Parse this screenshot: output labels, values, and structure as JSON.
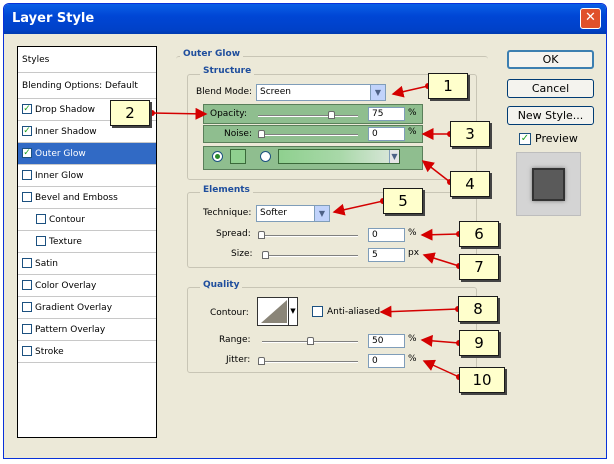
{
  "window": {
    "title": "Layer Style",
    "close_glyph": "✕"
  },
  "left_panel": {
    "header": "Styles",
    "blending": "Blending Options: Default",
    "items": [
      {
        "label": "Drop Shadow",
        "checked": true
      },
      {
        "label": "Inner Shadow",
        "checked": true
      },
      {
        "label": "Outer Glow",
        "checked": true
      },
      {
        "label": "Inner Glow",
        "checked": false
      },
      {
        "label": "Bevel and Emboss",
        "checked": false
      },
      {
        "label": "Contour",
        "checked": false
      },
      {
        "label": "Texture",
        "checked": false
      },
      {
        "label": "Satin",
        "checked": false
      },
      {
        "label": "Color Overlay",
        "checked": false
      },
      {
        "label": "Gradient Overlay",
        "checked": false
      },
      {
        "label": "Pattern Overlay",
        "checked": false
      },
      {
        "label": "Stroke",
        "checked": false
      }
    ]
  },
  "outer_glow": {
    "title": "Outer Glow",
    "structure": {
      "title": "Structure",
      "blend_mode_label": "Blend Mode:",
      "blend_mode_value": "Screen",
      "opacity_label": "Opacity:",
      "opacity_value": "75",
      "opacity_unit": "%",
      "opacity_fraction": 0.75,
      "noise_label": "Noise:",
      "noise_value": "0",
      "noise_unit": "%",
      "noise_fraction": 0
    },
    "elements": {
      "title": "Elements",
      "technique_label": "Technique:",
      "technique_value": "Softer",
      "spread_label": "Spread:",
      "spread_value": "0",
      "spread_unit": "%",
      "size_label": "Size:",
      "size_value": "5",
      "size_unit": "px"
    },
    "quality": {
      "title": "Quality",
      "contour_label": "Contour:",
      "anti_aliased_label": "Anti-aliased",
      "range_label": "Range:",
      "range_value": "50",
      "range_unit": "%",
      "range_fraction": 0.5,
      "jitter_label": "Jitter:",
      "jitter_value": "0",
      "jitter_unit": "%"
    }
  },
  "buttons": {
    "ok": "OK",
    "cancel": "Cancel",
    "new_style": "New Style...",
    "preview": "Preview"
  },
  "callouts": [
    "1",
    "2",
    "3",
    "4",
    "5",
    "6",
    "7",
    "8",
    "9",
    "10"
  ],
  "colors": {
    "accent_green": "#8fbe8f",
    "selection": "#316ac5",
    "arrow": "#d40000",
    "callout_bg": "#ffffcc"
  }
}
